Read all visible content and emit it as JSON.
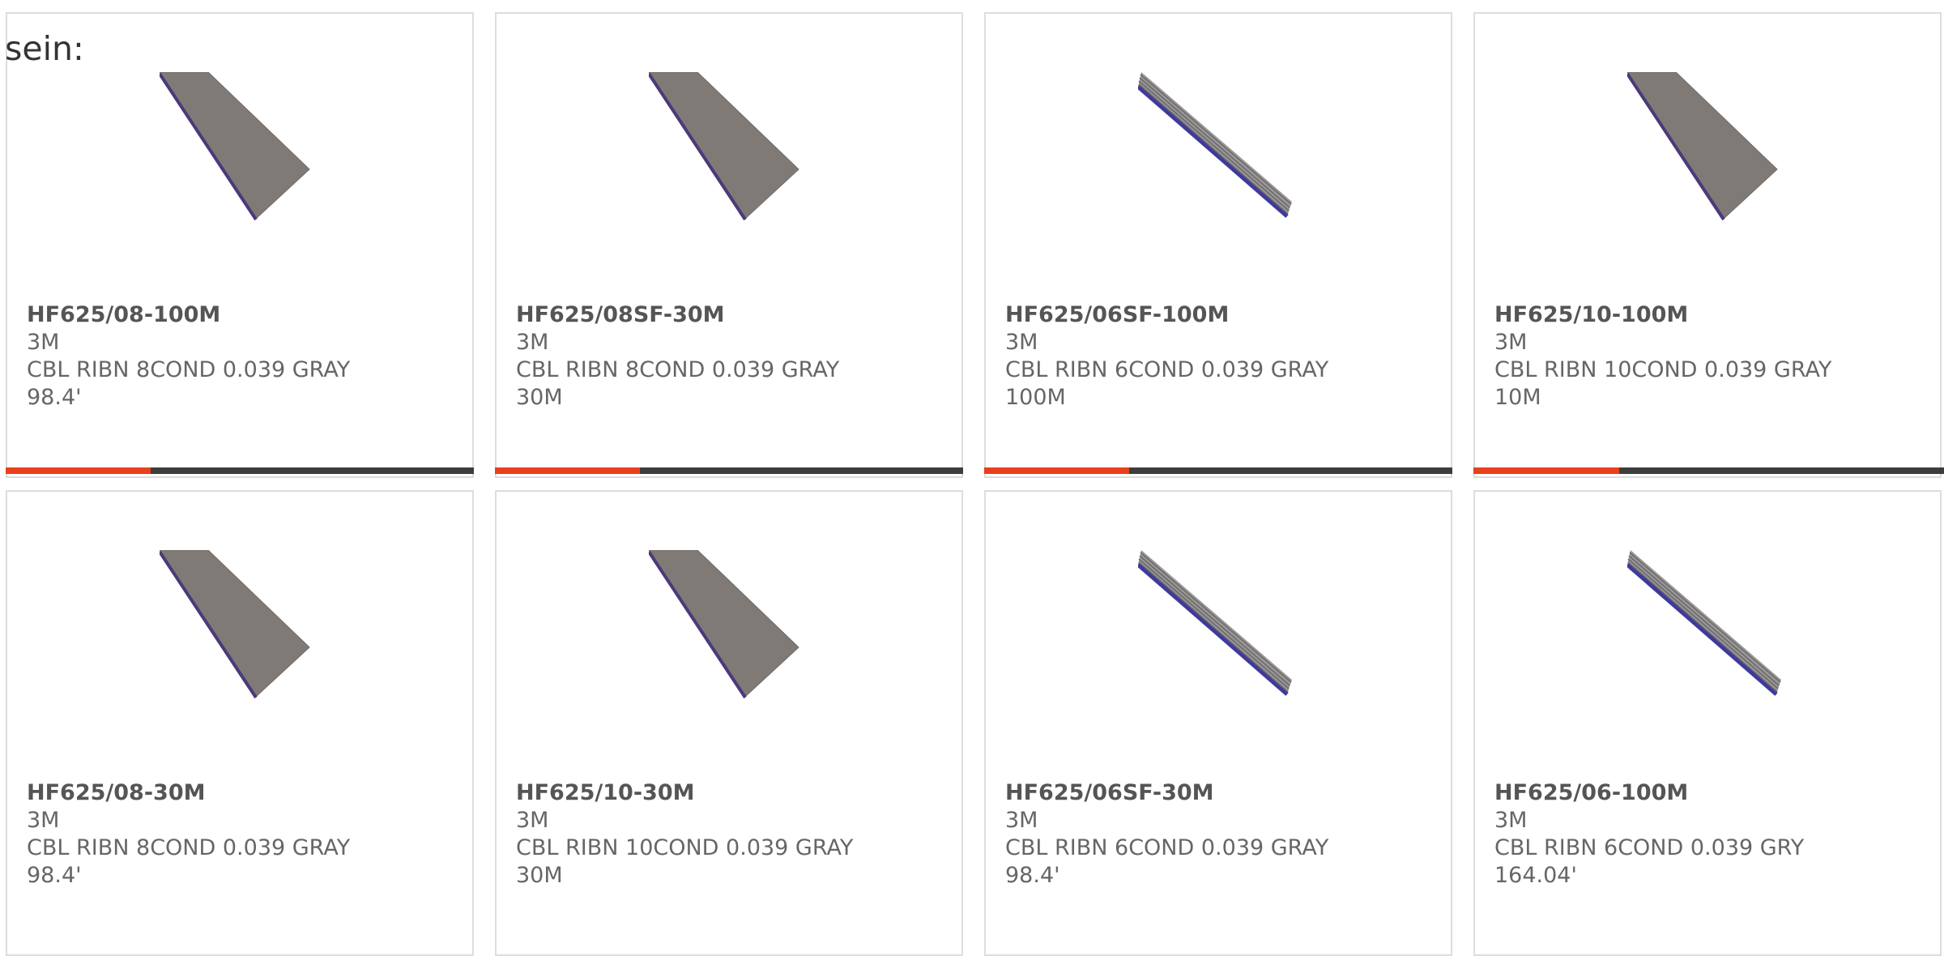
{
  "lead_text": "sein:",
  "colors": {
    "accent": "#e8401c",
    "bar_track": "#3d3d3d",
    "card_border": "#dddddd",
    "text": "#666666"
  },
  "products": [
    {
      "part_number": "HF625/08-100M",
      "manufacturer": "3M",
      "description": "CBL RIBN 8COND 0.039 GRAY",
      "length": "98.4'",
      "image": "flat-ribbon-cable-image",
      "highlight_fraction": 0.31
    },
    {
      "part_number": "HF625/08SF-30M",
      "manufacturer": "3M",
      "description": "CBL RIBN 8COND 0.039 GRAY",
      "length": "30M",
      "image": "flat-ribbon-cable-image",
      "highlight_fraction": 0.31
    },
    {
      "part_number": "HF625/06SF-100M",
      "manufacturer": "3M",
      "description": "CBL RIBN 6COND 0.039 GRAY",
      "length": "100M",
      "image": "ribbon-strands-cable-image",
      "highlight_fraction": 0.31
    },
    {
      "part_number": "HF625/10-100M",
      "manufacturer": "3M",
      "description": "CBL RIBN 10COND 0.039 GRAY",
      "length": "10M",
      "image": "flat-ribbon-cable-image",
      "highlight_fraction": 0.31
    },
    {
      "part_number": "HF625/08-30M",
      "manufacturer": "3M",
      "description": "CBL RIBN 8COND 0.039 GRAY",
      "length": "98.4'",
      "image": "flat-ribbon-cable-image",
      "highlight_fraction": null
    },
    {
      "part_number": "HF625/10-30M",
      "manufacturer": "3M",
      "description": "CBL RIBN 10COND 0.039 GRAY",
      "length": "30M",
      "image": "flat-ribbon-cable-image",
      "highlight_fraction": null
    },
    {
      "part_number": "HF625/06SF-30M",
      "manufacturer": "3M",
      "description": "CBL RIBN 6COND 0.039 GRAY",
      "length": "98.4'",
      "image": "ribbon-strands-cable-image",
      "highlight_fraction": null
    },
    {
      "part_number": "HF625/06-100M",
      "manufacturer": "3M",
      "description": "CBL RIBN 6COND 0.039 GRY",
      "length": "164.04'",
      "image": "ribbon-strands-cable-image",
      "highlight_fraction": null
    }
  ]
}
